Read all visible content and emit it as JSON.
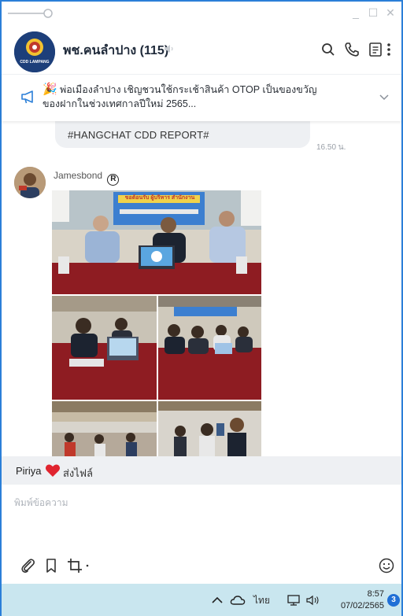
{
  "window": {
    "controls": [
      "minimize",
      "maximize",
      "close"
    ]
  },
  "header": {
    "avatar_text": "CDD LAMPANG",
    "title": "พช.คนลำปาง (115)",
    "icons": [
      "mute-icon",
      "search-icon",
      "phone-icon",
      "notes-icon",
      "more-icon"
    ]
  },
  "announcement": {
    "emoji": "🎉",
    "line1": "พ่อเมืองลำปาง เชิญชวนใช้กระเช้าสินค้า OTOP เป็นของขวัญ",
    "line2": "ของฝากในช่วงเทศกาลปีใหม่ 2565..."
  },
  "chat": {
    "prev_message": "#HANGCHAT CDD REPORT#",
    "prev_time": "16.50 น.",
    "sender_name": "Jamesbond",
    "verified_symbol": "R",
    "photo1_banner": "ขอต้อนรับ ผู้บริหาร สำนักงาน"
  },
  "reply": {
    "name": "Piriya",
    "text": "ส่งไฟล์"
  },
  "input": {
    "placeholder": "พิมพ์ข้อความ"
  },
  "taskbar": {
    "language": "ไทย",
    "time": "8:57",
    "date": "07/02/2565",
    "badge": "3"
  },
  "colors": {
    "accent": "#2b7fd8",
    "bubble": "#eef0f3",
    "taskbar": "#c9e6ef",
    "heart": "#e0242f",
    "badge": "#1f6fd6"
  }
}
